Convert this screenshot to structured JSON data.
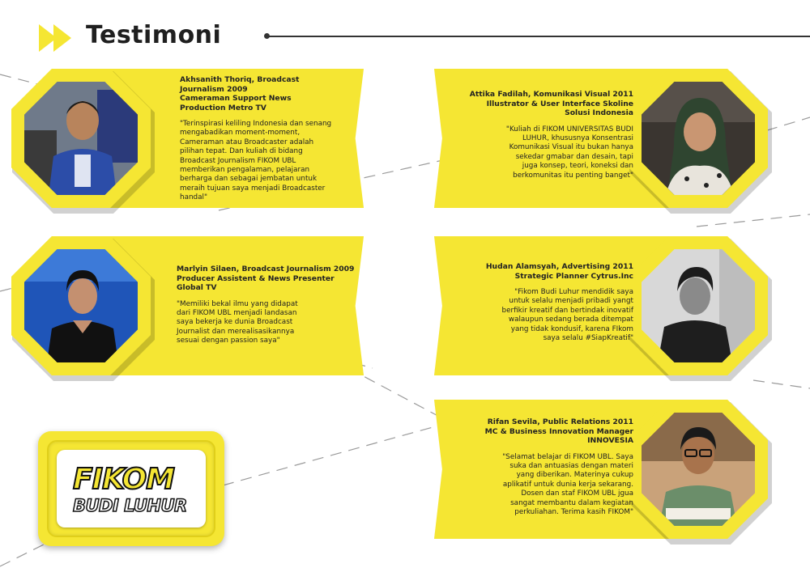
{
  "header": {
    "title": "Testimoni",
    "icon": "double-chevron-right-icon"
  },
  "colors": {
    "accent": "#f5e633",
    "text": "#222222"
  },
  "testimonials": [
    {
      "name": "Akhsanith Thoriq, Broadcast\nJournalism 2009\nCameraman Support News\nProduction Metro TV",
      "quote": "\"Terinspirasi keliling Indonesia dan senang\nmengabadikan moment-moment,\nCameraman atau Broadcaster adalah\npilihan tepat. Dan kuliah di bidang\nBroadcast Journalism FIKOM UBL\nmemberikan pengalaman, pelajaran\nberharga dan sebagai jembatan untuk\nmeraih tujuan saya menjadi Broadcaster\nhandal\""
    },
    {
      "name": "Attika Fadilah, Komunikasi Visual 2011\nIllustrator & User Interface Skoline\nSolusi Indonesia",
      "quote": "\"Kuliah di FIKOM UNIVERSITAS BUDI\nLUHUR, khususnya Konsentrasi\nKomunikasi Visual itu bukan hanya\nsekedar gmabar dan desain, tapi\njuga konsep, teori, koneksi dan\nberkomunitas itu penting banget\""
    },
    {
      "name": "Marlyin Silaen, Broadcast Journalism 2009\nProducer Assistent & News Presenter\nGlobal TV",
      "quote": "\"Memiliki bekal ilmu yang didapat\ndari FIKOM UBL menjadi landasan\nsaya bekerja ke dunia Broadcast\nJournalist dan merealisasikannya\nsesuai dengan passion saya\""
    },
    {
      "name": "Hudan Alamsyah, Advertising 2011\nStrategic Planner Cytrus.Inc",
      "quote": "\"Fikom Budi Luhur mendidik saya\nuntuk selalu menjadi pribadi yangt\nberfikir kreatif dan bertindak inovatif\nwalaupun sedang berada ditempat\nyang tidak kondusif, karena FIkom\nsaya selalu #SiapKreatif\""
    },
    {
      "name": "Rifan Sevila, Public Relations 2011\nMC & Business Innovation Manager\nINNOVESIA",
      "quote": "\"Selamat belajar di FIKOM UBL. Saya\nsuka dan antuasias dengan materi\nyang diberikan. Materinya cukup\naplikatif untuk dunia kerja sekarang.\nDosen dan staf FIKOM UBL jgua\nsangat membantu dalam kegiatan\nperkuliahan. Terima kasih FIKOM\""
    }
  ],
  "logo": {
    "line1": "FIKOM",
    "line2": "BUDI LUHUR"
  }
}
